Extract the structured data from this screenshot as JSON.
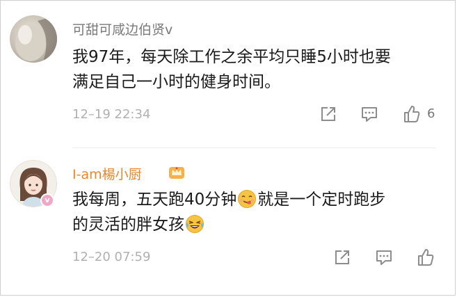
{
  "comments": [
    {
      "username": "可甜可咸边伯贤v",
      "text_lines": [
        "我97年，每天除工作之余平均只睡5小时也要",
        "满足自己一小时的健身时间。"
      ],
      "timestamp": "12–19 22:34",
      "like_count": "6",
      "icons": [
        "avatar",
        "share-icon",
        "reply-icon",
        "like-icon"
      ]
    },
    {
      "username": "I-am楊小厨",
      "text_part1": "我每周，五天跑40分钟",
      "text_part2": "就是一个定时跑步",
      "text_line2": "的灵活的胖女孩",
      "timestamp": "12–20 07:59",
      "icons": [
        "avatar",
        "verified-badge",
        "crown-icon",
        "yummy-emoji",
        "laughing-emoji",
        "share-icon",
        "reply-icon",
        "like-icon"
      ]
    }
  ],
  "colors": {
    "username_gray": "#7a7a7a",
    "username_orange": "#e8862a",
    "text": "#1a1a1a",
    "meta": "#b0b0b0",
    "icon": "#8c8c8c"
  }
}
